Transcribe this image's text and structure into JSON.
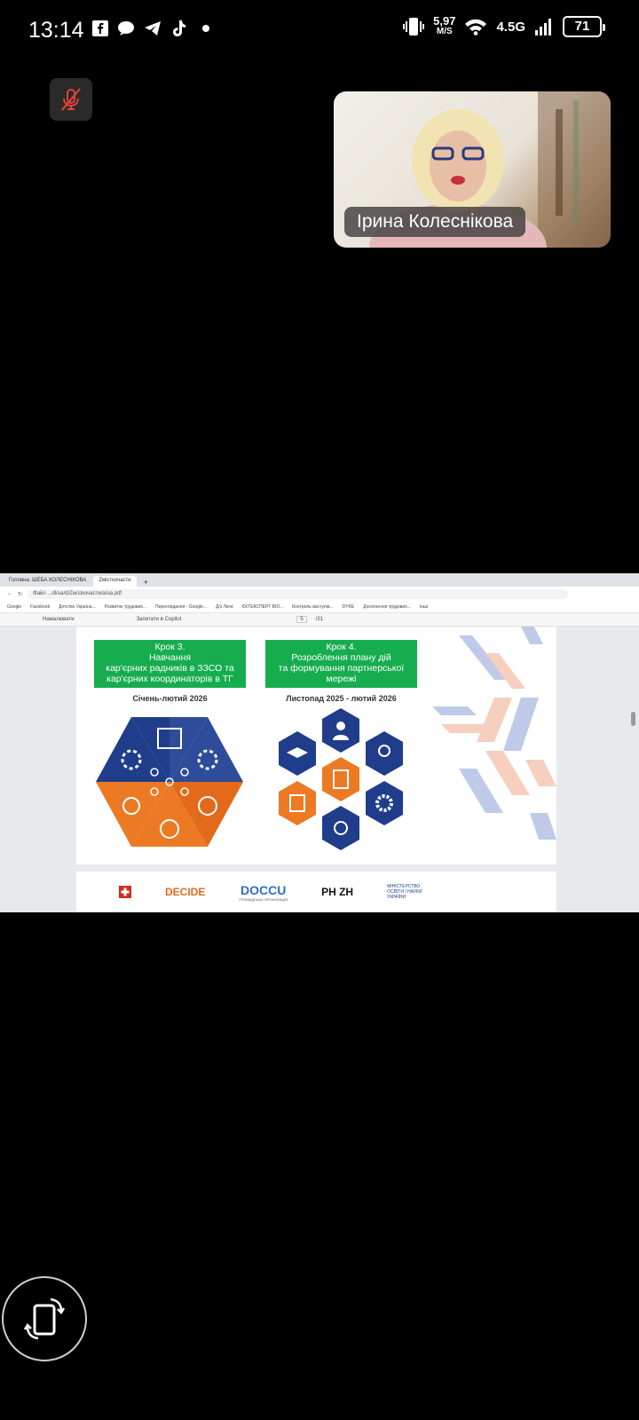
{
  "status_bar": {
    "time": "13:14",
    "speed_value": "5,97",
    "speed_unit": "M/S",
    "network": "4.5G",
    "battery": "71"
  },
  "meeting": {
    "participant_name": "Ірина Колеснікова",
    "mic_state": "muted"
  },
  "browser": {
    "tabs": [
      "Головна. ШЕБА КОЛЕСНІКОВА",
      "Zмісткочасти"
    ],
    "url": "Файл  ...dl/ua/d/Zм/stкочасти/а/ua.pdf",
    "bookmarks": [
      "Google",
      "Facebook",
      "Детство Україна...",
      "Розвиток трудових...",
      "Переглядання - Google...",
      "Д/з Легкі",
      "ЄКТЕКСПЕРТ ВОЇ...",
      "Контроль виступів...",
      "DYKE",
      "Досягнення трудових...",
      "Інші"
    ],
    "pdf_toolbar": [
      "Намалювати",
      "Запитати в Copilot",
      "5",
      "/21"
    ]
  },
  "slide": {
    "step3": {
      "title": "Крок 3.",
      "line1": "Навчання",
      "line2": "кар'єрних радників в ЗЗСО та",
      "line3": "кар'єрних координаторів в ТГ",
      "date": "Січень-лютий 2026"
    },
    "step4": {
      "title": "Крок 4.",
      "line1": "Розроблення плану дій",
      "line2": "та формування партнерської",
      "line3": "мережі",
      "date": "Листопад 2025 - лютий 2026"
    },
    "footer_logos": {
      "decide": "DECIDE",
      "docu": "DOCCU",
      "docu_sub": "ГРОМАДСЬКА ОРГАНІЗАЦІЯ",
      "phzh": "PH ZH",
      "mon": "МІНІСТЕРСТВО ОСВІТИ І НАУКИ УКРАЇНИ"
    }
  },
  "colors": {
    "green": "#16ad4e",
    "navy": "#2e4c9a",
    "orange": "#ec7a24",
    "battery_border": "#ffffff"
  }
}
